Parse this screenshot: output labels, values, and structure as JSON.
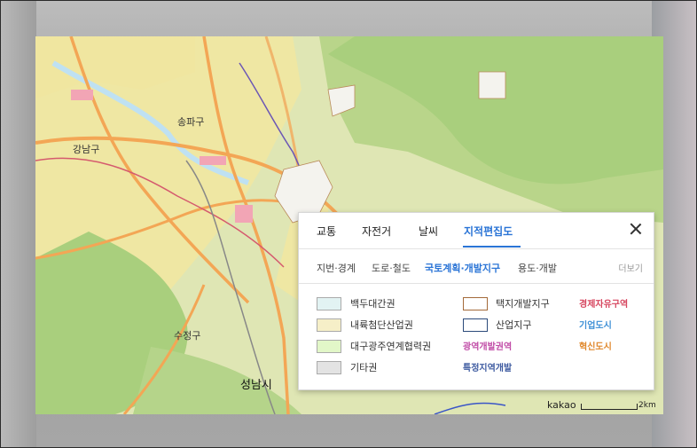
{
  "map": {
    "labels": {
      "songpa": "송파구",
      "gangnam": "강남구",
      "sujeong": "수정구",
      "seongnam": "성남시"
    }
  },
  "panel": {
    "tabs": [
      "교통",
      "자전거",
      "날씨",
      "지적편집도"
    ],
    "active_tab": "지적편집도",
    "subtabs": [
      "지번·경계",
      "도로·철도",
      "국토계획·개발지구",
      "용도·개발"
    ],
    "active_subtab": "국토계획·개발지구",
    "more_label": "더보기",
    "legend_left": [
      {
        "label": "백두대간권",
        "color": "#e2f3f3"
      },
      {
        "label": "내륙첨단산업권",
        "color": "#f6efc8"
      },
      {
        "label": "대구광주연계협력권",
        "color": "#e2f7c8"
      },
      {
        "label": "기타권",
        "color": "#e3e3e3"
      }
    ],
    "legend_mid": [
      {
        "label": "택지개발지구",
        "color": "#a46a3a"
      },
      {
        "label": "산업지구",
        "color": "#2b4a7a"
      }
    ],
    "badges_mid": [
      {
        "label": "광역개발권역",
        "color": "#c04aa6"
      },
      {
        "label": "특정지역개발",
        "color": "#3d5aa0"
      }
    ],
    "badges_right": [
      {
        "label": "경제자유구역",
        "color": "#d6455e"
      },
      {
        "label": "기업도시",
        "color": "#3d8fd6"
      },
      {
        "label": "혁신도시",
        "color": "#e0882c"
      }
    ]
  },
  "footer": {
    "brand": "kakao",
    "scale": "2km"
  }
}
